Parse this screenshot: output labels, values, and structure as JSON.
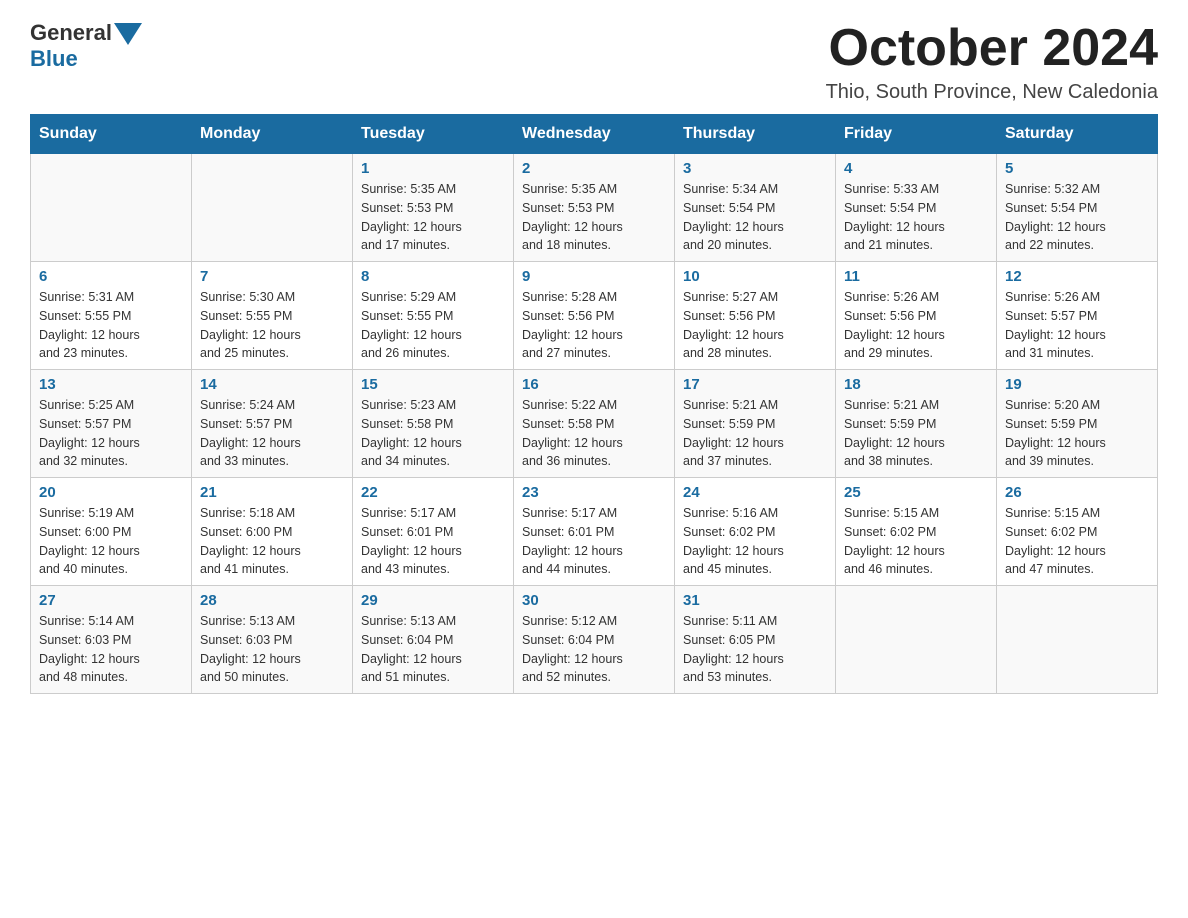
{
  "header": {
    "logo_general": "General",
    "logo_blue": "Blue",
    "month_title": "October 2024",
    "location": "Thio, South Province, New Caledonia"
  },
  "weekdays": [
    "Sunday",
    "Monday",
    "Tuesday",
    "Wednesday",
    "Thursday",
    "Friday",
    "Saturday"
  ],
  "weeks": [
    [
      {
        "day": "",
        "info": ""
      },
      {
        "day": "",
        "info": ""
      },
      {
        "day": "1",
        "info": "Sunrise: 5:35 AM\nSunset: 5:53 PM\nDaylight: 12 hours\nand 17 minutes."
      },
      {
        "day": "2",
        "info": "Sunrise: 5:35 AM\nSunset: 5:53 PM\nDaylight: 12 hours\nand 18 minutes."
      },
      {
        "day": "3",
        "info": "Sunrise: 5:34 AM\nSunset: 5:54 PM\nDaylight: 12 hours\nand 20 minutes."
      },
      {
        "day": "4",
        "info": "Sunrise: 5:33 AM\nSunset: 5:54 PM\nDaylight: 12 hours\nand 21 minutes."
      },
      {
        "day": "5",
        "info": "Sunrise: 5:32 AM\nSunset: 5:54 PM\nDaylight: 12 hours\nand 22 minutes."
      }
    ],
    [
      {
        "day": "6",
        "info": "Sunrise: 5:31 AM\nSunset: 5:55 PM\nDaylight: 12 hours\nand 23 minutes."
      },
      {
        "day": "7",
        "info": "Sunrise: 5:30 AM\nSunset: 5:55 PM\nDaylight: 12 hours\nand 25 minutes."
      },
      {
        "day": "8",
        "info": "Sunrise: 5:29 AM\nSunset: 5:55 PM\nDaylight: 12 hours\nand 26 minutes."
      },
      {
        "day": "9",
        "info": "Sunrise: 5:28 AM\nSunset: 5:56 PM\nDaylight: 12 hours\nand 27 minutes."
      },
      {
        "day": "10",
        "info": "Sunrise: 5:27 AM\nSunset: 5:56 PM\nDaylight: 12 hours\nand 28 minutes."
      },
      {
        "day": "11",
        "info": "Sunrise: 5:26 AM\nSunset: 5:56 PM\nDaylight: 12 hours\nand 29 minutes."
      },
      {
        "day": "12",
        "info": "Sunrise: 5:26 AM\nSunset: 5:57 PM\nDaylight: 12 hours\nand 31 minutes."
      }
    ],
    [
      {
        "day": "13",
        "info": "Sunrise: 5:25 AM\nSunset: 5:57 PM\nDaylight: 12 hours\nand 32 minutes."
      },
      {
        "day": "14",
        "info": "Sunrise: 5:24 AM\nSunset: 5:57 PM\nDaylight: 12 hours\nand 33 minutes."
      },
      {
        "day": "15",
        "info": "Sunrise: 5:23 AM\nSunset: 5:58 PM\nDaylight: 12 hours\nand 34 minutes."
      },
      {
        "day": "16",
        "info": "Sunrise: 5:22 AM\nSunset: 5:58 PM\nDaylight: 12 hours\nand 36 minutes."
      },
      {
        "day": "17",
        "info": "Sunrise: 5:21 AM\nSunset: 5:59 PM\nDaylight: 12 hours\nand 37 minutes."
      },
      {
        "day": "18",
        "info": "Sunrise: 5:21 AM\nSunset: 5:59 PM\nDaylight: 12 hours\nand 38 minutes."
      },
      {
        "day": "19",
        "info": "Sunrise: 5:20 AM\nSunset: 5:59 PM\nDaylight: 12 hours\nand 39 minutes."
      }
    ],
    [
      {
        "day": "20",
        "info": "Sunrise: 5:19 AM\nSunset: 6:00 PM\nDaylight: 12 hours\nand 40 minutes."
      },
      {
        "day": "21",
        "info": "Sunrise: 5:18 AM\nSunset: 6:00 PM\nDaylight: 12 hours\nand 41 minutes."
      },
      {
        "day": "22",
        "info": "Sunrise: 5:17 AM\nSunset: 6:01 PM\nDaylight: 12 hours\nand 43 minutes."
      },
      {
        "day": "23",
        "info": "Sunrise: 5:17 AM\nSunset: 6:01 PM\nDaylight: 12 hours\nand 44 minutes."
      },
      {
        "day": "24",
        "info": "Sunrise: 5:16 AM\nSunset: 6:02 PM\nDaylight: 12 hours\nand 45 minutes."
      },
      {
        "day": "25",
        "info": "Sunrise: 5:15 AM\nSunset: 6:02 PM\nDaylight: 12 hours\nand 46 minutes."
      },
      {
        "day": "26",
        "info": "Sunrise: 5:15 AM\nSunset: 6:02 PM\nDaylight: 12 hours\nand 47 minutes."
      }
    ],
    [
      {
        "day": "27",
        "info": "Sunrise: 5:14 AM\nSunset: 6:03 PM\nDaylight: 12 hours\nand 48 minutes."
      },
      {
        "day": "28",
        "info": "Sunrise: 5:13 AM\nSunset: 6:03 PM\nDaylight: 12 hours\nand 50 minutes."
      },
      {
        "day": "29",
        "info": "Sunrise: 5:13 AM\nSunset: 6:04 PM\nDaylight: 12 hours\nand 51 minutes."
      },
      {
        "day": "30",
        "info": "Sunrise: 5:12 AM\nSunset: 6:04 PM\nDaylight: 12 hours\nand 52 minutes."
      },
      {
        "day": "31",
        "info": "Sunrise: 5:11 AM\nSunset: 6:05 PM\nDaylight: 12 hours\nand 53 minutes."
      },
      {
        "day": "",
        "info": ""
      },
      {
        "day": "",
        "info": ""
      }
    ]
  ]
}
